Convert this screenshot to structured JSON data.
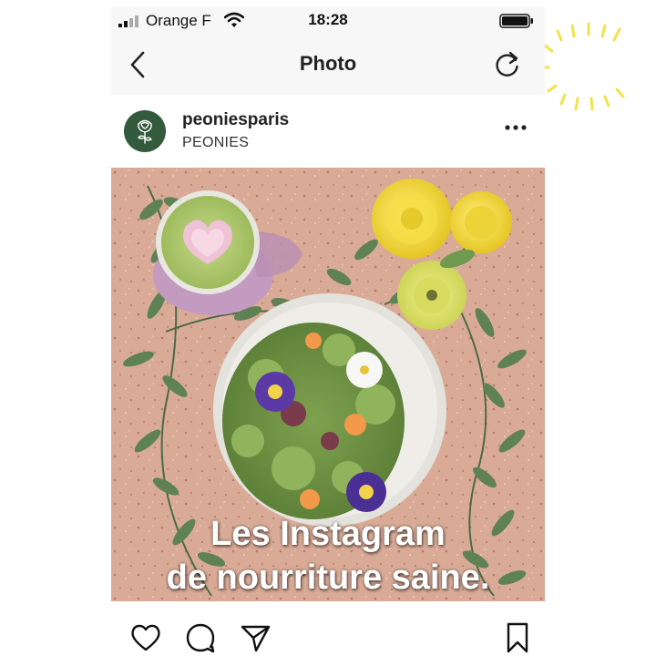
{
  "status_bar": {
    "carrier": "Orange F",
    "time": "18:28"
  },
  "nav": {
    "title": "Photo"
  },
  "post": {
    "username": "peoniesparis",
    "location": "PEONIES",
    "caption_line1": "Les Instagram",
    "caption_line2": "de nourriture saine."
  },
  "icons": {
    "signal": "signal-bars-icon",
    "wifi": "wifi-icon",
    "battery": "battery-icon",
    "back": "chevron-left-icon",
    "refresh": "refresh-icon",
    "avatar": "rose-logo-icon",
    "more": "more-dots-icon",
    "like": "heart-icon",
    "comment": "comment-bubble-icon",
    "share": "paper-plane-icon",
    "save": "bookmark-icon"
  },
  "colors": {
    "sparkle": "#f2e24b",
    "avatar_bg": "#345a3d",
    "bar_bg": "#f7f7f7",
    "photo_bg": "#d9ab97"
  }
}
